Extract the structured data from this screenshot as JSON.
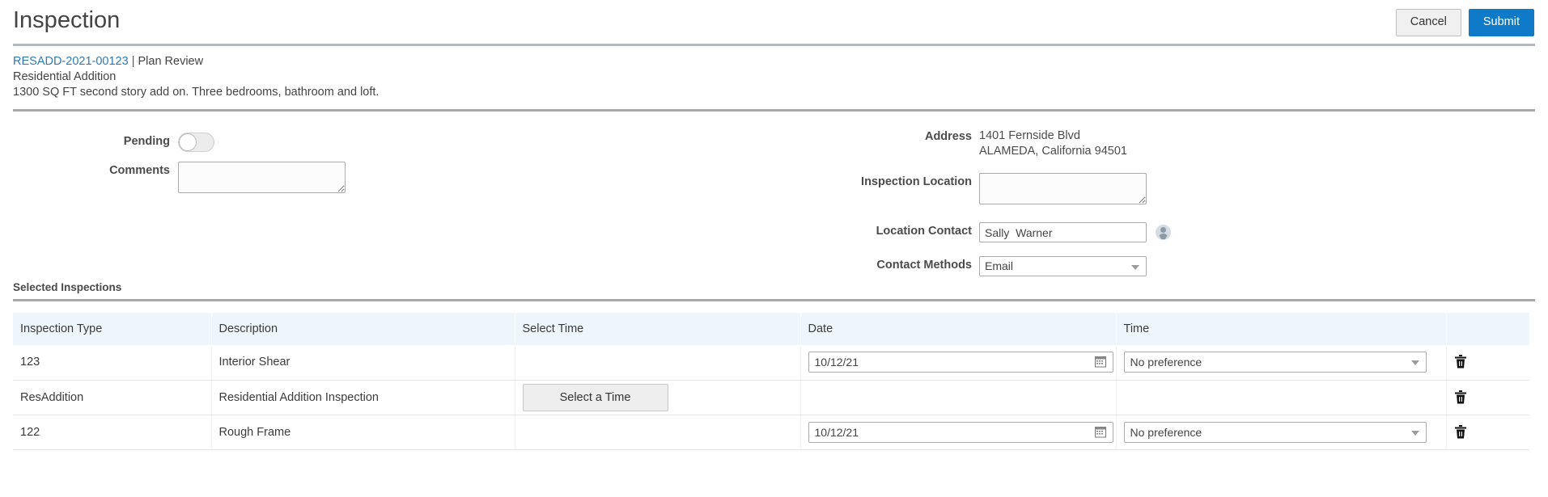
{
  "header": {
    "title": "Inspection",
    "cancel_label": "Cancel",
    "submit_label": "Submit",
    "accent_blue": "#0f7ac7",
    "link_blue": "#2f7ab5"
  },
  "record": {
    "number": "RESADD-2021-00123",
    "separator": " | ",
    "workflow": "Plan Review",
    "type": "Residential Addition",
    "description": "1300 SQ FT second story add on. Three bedrooms, bathroom and loft."
  },
  "form": {
    "pending_label": "Pending",
    "pending_state": "off",
    "comments_label": "Comments",
    "comments_value": "",
    "address_label": "Address",
    "address_line1": "1401 Fernside Blvd",
    "address_line2": "ALAMEDA, California 94501",
    "inspection_location_label": "Inspection Location",
    "inspection_location_value": "",
    "location_contact_label": "Location Contact",
    "location_contact_value": "Sally  Warner",
    "contact_methods_label": "Contact Methods",
    "contact_methods_value": "Email"
  },
  "section": {
    "selected_inspections_title": "Selected Inspections"
  },
  "table": {
    "columns": [
      "Inspection Type",
      "Description",
      "Select Time",
      "Date",
      "Time",
      ""
    ],
    "rows": [
      {
        "inspection_type": "123",
        "description": "Interior Shear",
        "select_time_button": "",
        "date": "10/12/21",
        "time": "No preference",
        "has_date": true,
        "has_time": true,
        "has_select_button": false
      },
      {
        "inspection_type": "ResAddition",
        "description": "Residential Addition Inspection",
        "select_time_button": "Select a Time",
        "date": "",
        "time": "",
        "has_date": false,
        "has_time": false,
        "has_select_button": true
      },
      {
        "inspection_type": "122",
        "description": "Rough Frame",
        "select_time_button": "",
        "date": "10/12/21",
        "time": "No preference",
        "has_date": true,
        "has_time": true,
        "has_select_button": false
      }
    ]
  },
  "icons": {
    "calendar": "calendar-icon",
    "trash": "trash-icon",
    "avatar": "person-avatar-icon",
    "caret": "chevron-down-icon"
  }
}
